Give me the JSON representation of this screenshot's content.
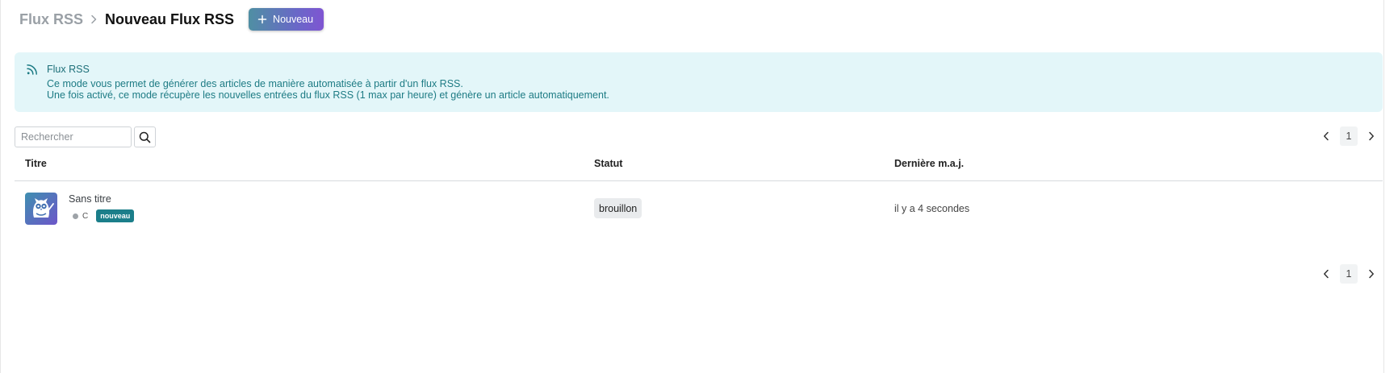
{
  "header": {
    "breadcrumb_root": "Flux RSS",
    "title": "Nouveau Flux RSS",
    "new_button_label": "Nouveau"
  },
  "banner": {
    "title": "Flux RSS",
    "line1": "Ce mode vous permet de générer des articles de manière automatisée à partir d'un flux RSS.",
    "line2": "Une fois activé, ce mode récupère les nouvelles entrées du flux RSS (1 max par heure) et génère un article automatiquement."
  },
  "search": {
    "placeholder": "Rechercher",
    "value": ""
  },
  "pagination": {
    "current_page": "1"
  },
  "table": {
    "columns": [
      "Titre",
      "Statut",
      "Dernière m.a.j."
    ],
    "rows": [
      {
        "title": "Sans titre",
        "meta_letter": "C",
        "badge": "nouveau",
        "status": "brouillon",
        "updated": "il y a 4 secondes"
      }
    ]
  },
  "colors": {
    "banner_bg": "#e3f6f9",
    "banner_text": "#1d7b84",
    "badge_new": "#1b7e8a",
    "button_gradient_start": "#4f8fa3",
    "button_gradient_end": "#7f55d2"
  },
  "icons": [
    "chevron-right-icon",
    "plus-icon",
    "rss-icon",
    "search-icon",
    "chevron-left-icon",
    "owl-avatar-icon"
  ]
}
